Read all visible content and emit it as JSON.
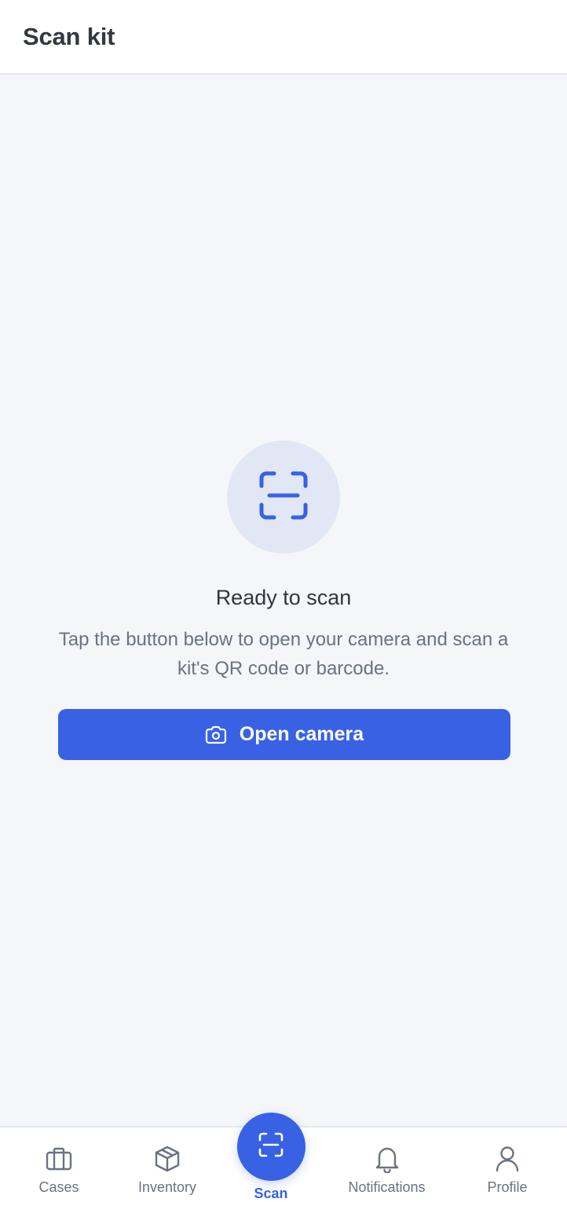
{
  "header": {
    "title": "Scan kit"
  },
  "empty_state": {
    "icon": "scan-icon",
    "title": "Ready to scan",
    "description": "Tap the button below to open your camera and scan a kit's QR code or barcode.",
    "button_label": "Open camera",
    "button_icon": "camera-icon"
  },
  "nav": {
    "items": [
      {
        "label": "Cases",
        "icon": "briefcase-icon"
      },
      {
        "label": "Inventory",
        "icon": "box-icon"
      },
      {
        "label": "Scan",
        "icon": "scan-icon",
        "active": true
      },
      {
        "label": "Notifications",
        "icon": "bell-icon"
      },
      {
        "label": "Profile",
        "icon": "user-icon"
      }
    ]
  },
  "colors": {
    "accent": "#3862e3",
    "background": "#f4f6f9",
    "scan_circle": "#e1e7f5",
    "muted_text": "#6b7280"
  }
}
